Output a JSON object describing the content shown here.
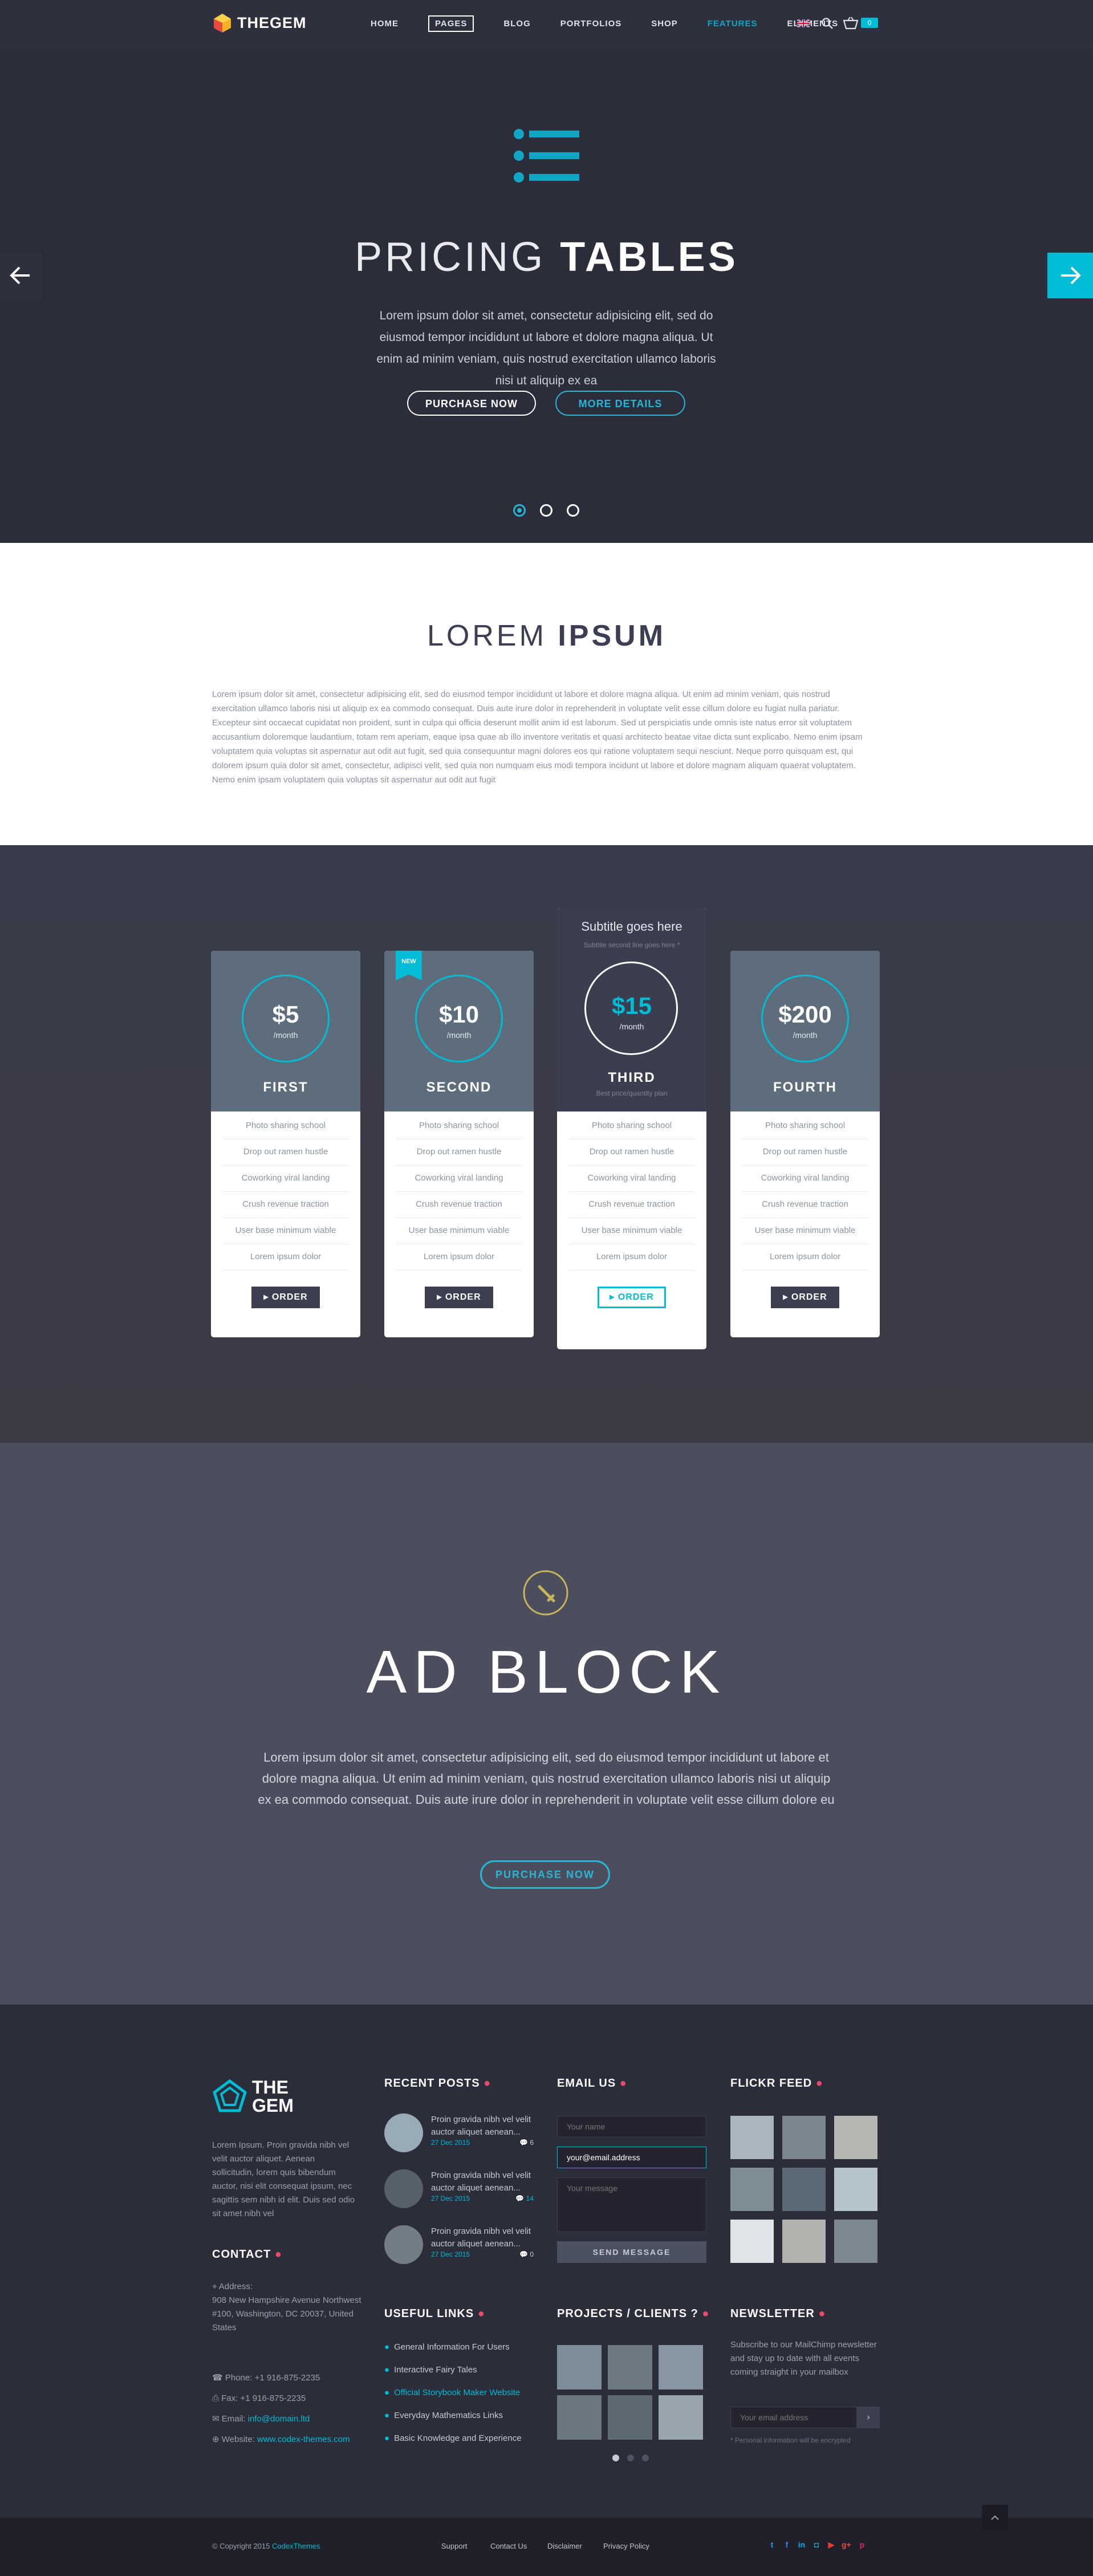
{
  "colors": {
    "accent": "#00bcd4",
    "dark_bg": "#2b2d3b",
    "pricing_head": "#5d6d7c",
    "red_dot": "#e84c6a"
  },
  "header": {
    "logo_text": "THEGEM",
    "nav": [
      "HOME",
      "PAGES",
      "BLOG",
      "PORTFOLIOS",
      "SHOP",
      "FEATURES",
      "ELEMENTS"
    ],
    "active_nav": "FEATURES",
    "boxed_nav": "PAGES",
    "cart_count": "0",
    "icons": [
      "uk-flag-icon",
      "search-icon",
      "cart-icon"
    ]
  },
  "hero": {
    "title_light": "PRICING",
    "title_bold": "TABLES",
    "text": "Lorem ipsum dolor sit amet, consectetur adipisicing elit, sed do eiusmod tempor incididunt ut labore et dolore magna aliqua. Ut enim ad minim veniam, quis nostrud exercitation ullamco laboris nisi ut aliquip ex ea",
    "btn_purchase": "PURCHASE NOW",
    "btn_more": "MORE DETAILS",
    "slides": 3,
    "active_slide": 1
  },
  "lorem": {
    "title_light": "LOREM",
    "title_bold": "IPSUM",
    "body": "Lorem ipsum dolor sit amet, consectetur adipisicing elit, sed do eiusmod tempor incididunt ut labore et dolore magna aliqua. Ut enim ad minim veniam, quis nostrud exercitation ullamco laboris nisi ut aliquip ex ea commodo consequat. Duis aute irure dolor in reprehenderit in voluptate velit esse cillum dolore eu fugiat nulla pariatur. Excepteur sint occaecat cupidatat non proident, sunt in culpa qui officia deserunt mollit anim id est laborum. Sed ut perspiciatis unde omnis iste natus error sit voluptatem accusantium doloremque laudantium, totam rem aperiam, eaque ipsa quae ab illo inventore veritatis et quasi architecto beatae vitae dicta sunt explicabo. Nemo enim ipsam voluptatem quia voluptas sit aspernatur aut odit aut fugit, sed quia consequuntur magni dolores eos qui ratione voluptatem sequi nesciunt. Neque porro quisquam est, qui dolorem ipsum quia dolor sit amet, consectetur, adipisci velit, sed quia non numquam eius modi tempora incidunt ut labore et dolore magnam aliquam quaerat voluptatem. Nemo enim ipsam voluptatem quia voluptas sit aspernatur aut odit aut fugit"
  },
  "pricing": {
    "features": [
      "Photo sharing school",
      "Drop out ramen hustle",
      "Coworking viral landing",
      "Crush revenue traction",
      "User base minimum viable",
      "Lorem ipsum dolor"
    ],
    "plans": [
      {
        "price": "$5",
        "period": "/month",
        "name": "FIRST",
        "order": "ORDER"
      },
      {
        "price": "$10",
        "period": "/month",
        "name": "SECOND",
        "order": "ORDER",
        "badge": "NEW"
      },
      {
        "price": "$15",
        "period": "/month",
        "name": "THIRD",
        "order": "ORDER",
        "subtitle": "Subtitle goes here",
        "subtitle_small": "Subtitle second line goes here *",
        "note": "Best price/quantity plan"
      },
      {
        "price": "$200",
        "period": "/month",
        "name": "FOURTH",
        "order": "ORDER"
      }
    ]
  },
  "ad": {
    "title": "AD BLOCK",
    "text": "Lorem ipsum dolor sit amet, consectetur adipisicing elit, sed do eiusmod tempor incididunt ut labore et dolore magna aliqua. Ut enim ad minim veniam, quis nostrud exercitation ullamco laboris nisi ut aliquip ex ea commodo consequat. Duis aute irure dolor in reprehenderit in voluptate velit esse cillum dolore eu",
    "button": "PURCHASE NOW"
  },
  "footer": {
    "about": {
      "logo_line1": "THE",
      "logo_line2": "GEM",
      "text": "Lorem Ipsum. Proin gravida nibh vel velit auctor aliquet. Aenean sollicitudin, lorem quis bibendum auctor, nisi elit consequat ipsum, nec sagittis sem nibh id elit. Duis sed odio sit amet nibh vel"
    },
    "contact": {
      "title": "CONTACT",
      "address_label": "Address:",
      "address": "908 New Hampshire Avenue Northwest #100, Washington, DC 20037, United States",
      "phone": "Phone: +1 916-875-2235",
      "fax": "Fax: +1 916-875-2235",
      "email_label": "Email:",
      "email": "info@domain.ltd",
      "website_label": "Website:",
      "website": "www.codex-themes.com"
    },
    "recent_posts": {
      "title": "RECENT POSTS",
      "items": [
        {
          "title": "Proin gravida nibh vel velit auctor aliquet aenean...",
          "date": "27 Dec 2015",
          "comments": "6"
        },
        {
          "title": "Proin gravida nibh vel velit auctor aliquet aenean...",
          "date": "27 Dec 2015",
          "comments": "14"
        },
        {
          "title": "Proin gravida nibh vel velit auctor aliquet aenean...",
          "date": "27 Dec 2015",
          "comments": "0"
        }
      ]
    },
    "email_us": {
      "title": "EMAIL US",
      "name_placeholder": "Your name",
      "email_value": "your@email.address",
      "message_placeholder": "Your message",
      "send": "SEND MESSAGE"
    },
    "flickr": {
      "title": "FLICKR FEED"
    },
    "useful_links": {
      "title": "USEFUL LINKS",
      "items": [
        "General Information For Users",
        "Interactive Fairy Tales",
        "Official Storybook Maker Website",
        "Everyday Mathematics Links",
        "Basic Knowledge and Experience"
      ],
      "highlighted": 2
    },
    "projects": {
      "title": "PROJECTS / CLIENTS ?"
    },
    "newsletter": {
      "title": "NEWSLETTER",
      "text": "Subscribe to our MailChimp newsletter and stay up to date with all events coming straight in your mailbox",
      "placeholder": "Your email address",
      "note": "* Personal information will be encrypted"
    }
  },
  "bottom": {
    "copyright_prefix": "© Copyright 2015",
    "copyright_link": "CodexThemes",
    "links": [
      "Support",
      "Contact Us",
      "Disclaimer",
      "Privacy Policy"
    ],
    "social": [
      "twitter-icon",
      "facebook-icon",
      "linkedin-icon",
      "instagram-icon",
      "youtube-icon",
      "googleplus-icon",
      "pinterest-icon"
    ]
  }
}
